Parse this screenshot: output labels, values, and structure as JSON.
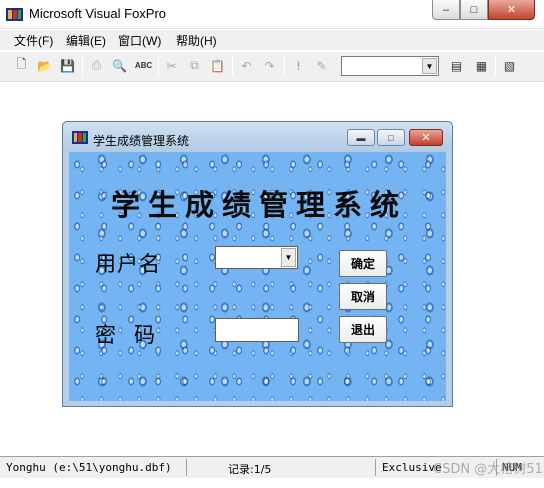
{
  "app": {
    "title": "Microsoft Visual FoxPro",
    "icon": "foxpro-app-icon",
    "caption_buttons": {
      "minimize": "–",
      "maximize": "□",
      "close": "✕"
    }
  },
  "menu": [
    {
      "label": "文件(F)"
    },
    {
      "label": "编辑(E)"
    },
    {
      "label": "窗口(W)"
    },
    {
      "label": "帮助(H)"
    }
  ],
  "toolbar": {
    "buttons": [
      {
        "name": "new-icon",
        "glyph": "🗋"
      },
      {
        "name": "open-icon",
        "glyph": "📂"
      },
      {
        "name": "save-icon",
        "glyph": "💾"
      },
      {
        "name": "print-icon",
        "glyph": "⎙"
      },
      {
        "name": "print-preview-icon",
        "glyph": "🔍"
      },
      {
        "name": "spell-check-icon",
        "glyph": "ABC"
      },
      {
        "name": "cut-icon",
        "glyph": "✂"
      },
      {
        "name": "copy-icon",
        "glyph": "⧉"
      },
      {
        "name": "paste-icon",
        "glyph": "📋"
      },
      {
        "name": "undo-icon",
        "glyph": "↶"
      },
      {
        "name": "redo-icon",
        "glyph": "↷"
      },
      {
        "name": "run-icon",
        "glyph": "!"
      },
      {
        "name": "modify-form-icon",
        "glyph": "✎"
      },
      {
        "name": "command-window-icon",
        "glyph": "▤"
      },
      {
        "name": "data-session-icon",
        "glyph": "▦"
      },
      {
        "name": "database-icon",
        "glyph": "▧"
      }
    ],
    "combo_value": ""
  },
  "status": {
    "path": "Yonghu (e:\\51\\yonghu.dbf)",
    "record": "记录:1/5",
    "mode": "Exclusive",
    "num": "NUM"
  },
  "watermark": "CSDN @大榕树51",
  "form": {
    "title": "学生成绩管理系统",
    "heading": "学生成绩管理系统",
    "username_label": "用户名",
    "password_label": "密码",
    "username_value": "",
    "password_value": "",
    "ok_label": "确定",
    "cancel_label": "取消",
    "exit_label": "退出",
    "background": "water-drops-blue"
  },
  "colors": {
    "form_background": "#74b4f2",
    "close_button": "#c4442c"
  }
}
